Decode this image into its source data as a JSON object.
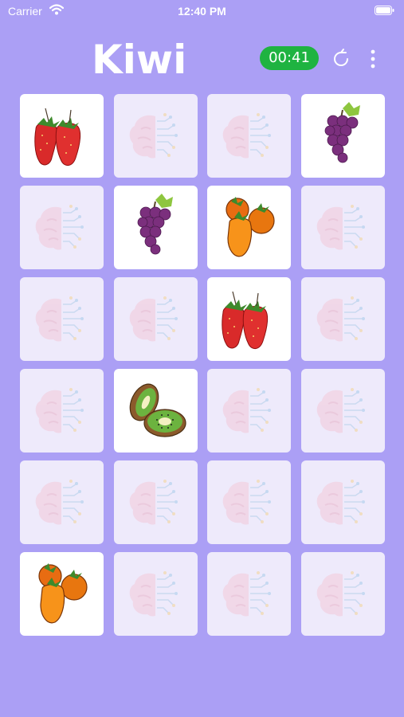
{
  "status_bar": {
    "carrier": "Carrier",
    "time": "12:40 PM"
  },
  "game": {
    "title": "Kiwi",
    "timer": "00:41",
    "restart_icon": "restart-icon",
    "menu_icon": "more-vertical-icon"
  },
  "colors": {
    "background": "#ab9ff5",
    "timer": "#1fb341",
    "card_face": "#ffffff",
    "card_back": "#eeeafb"
  },
  "board": {
    "columns": 4,
    "rows": 6,
    "cards": [
      {
        "state": "revealed",
        "fruit": "strawberry"
      },
      {
        "state": "hidden",
        "fruit": ""
      },
      {
        "state": "hidden",
        "fruit": ""
      },
      {
        "state": "revealed",
        "fruit": "grape"
      },
      {
        "state": "hidden",
        "fruit": ""
      },
      {
        "state": "revealed",
        "fruit": "grape"
      },
      {
        "state": "revealed",
        "fruit": "orange"
      },
      {
        "state": "hidden",
        "fruit": ""
      },
      {
        "state": "hidden",
        "fruit": ""
      },
      {
        "state": "hidden",
        "fruit": ""
      },
      {
        "state": "revealed",
        "fruit": "strawberry"
      },
      {
        "state": "hidden",
        "fruit": ""
      },
      {
        "state": "hidden",
        "fruit": ""
      },
      {
        "state": "revealed",
        "fruit": "kiwi"
      },
      {
        "state": "hidden",
        "fruit": ""
      },
      {
        "state": "hidden",
        "fruit": ""
      },
      {
        "state": "hidden",
        "fruit": ""
      },
      {
        "state": "hidden",
        "fruit": ""
      },
      {
        "state": "hidden",
        "fruit": ""
      },
      {
        "state": "hidden",
        "fruit": ""
      },
      {
        "state": "revealed",
        "fruit": "orange"
      },
      {
        "state": "hidden",
        "fruit": ""
      },
      {
        "state": "hidden",
        "fruit": ""
      },
      {
        "state": "hidden",
        "fruit": ""
      }
    ]
  }
}
